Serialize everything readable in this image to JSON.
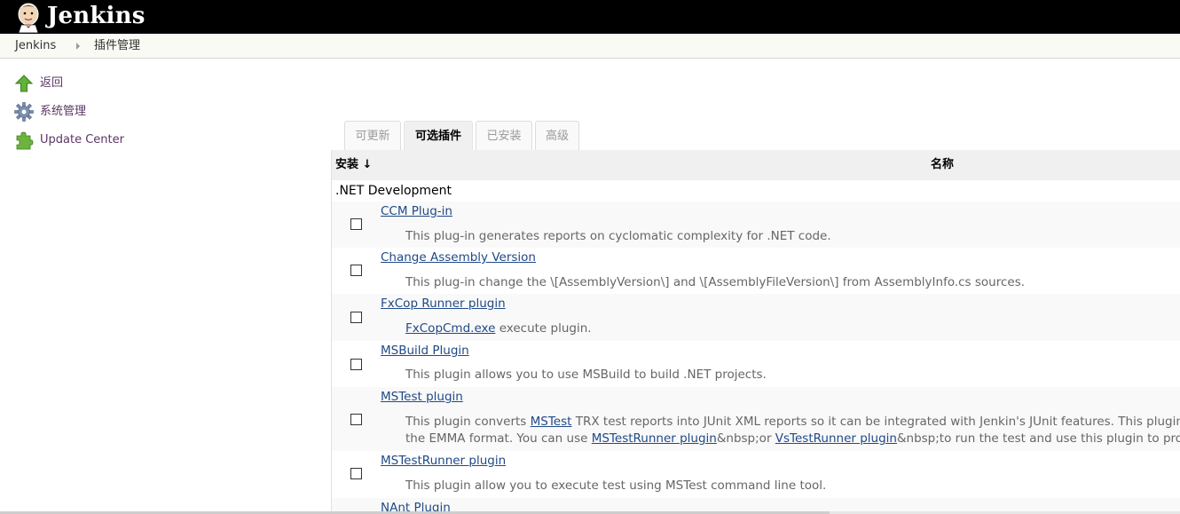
{
  "header": {
    "brand": "Jenkins"
  },
  "breadcrumb": {
    "items": [
      "Jenkins",
      "插件管理"
    ]
  },
  "side_panel": {
    "items": [
      {
        "label": "返回",
        "icon": "up-arrow-icon"
      },
      {
        "label": "系统管理",
        "icon": "gear-icon"
      },
      {
        "label": "Update Center",
        "icon": "puzzle-icon"
      }
    ]
  },
  "tabs": [
    {
      "label": "可更新",
      "active": false
    },
    {
      "label": "可选插件",
      "active": true
    },
    {
      "label": "已安装",
      "active": false
    },
    {
      "label": "高级",
      "active": false
    }
  ],
  "table": {
    "headers": {
      "install": "安装 ↓",
      "name": "名称"
    },
    "category": ".NET Development",
    "plugins": [
      {
        "name": "CCM Plug-in",
        "desc": "This plug-in generates reports on cyclomatic complexity for .NET code."
      },
      {
        "name": "Change Assembly Version",
        "desc": "This plug-in change the \\[AssemblyVersion\\] and \\[AssemblyFileVersion\\] from AssemblyInfo.cs sources."
      },
      {
        "name": "FxCop Runner plugin",
        "desc_link": "FxCopCmd.exe",
        "desc_rest": " execute plugin."
      },
      {
        "name": "MSBuild Plugin",
        "desc": "This plugin allows you to use MSBuild to build .NET projects."
      },
      {
        "name": "MSTest plugin",
        "line1_pre": "This plugin converts ",
        "line1_link": "MSTest",
        "line1_post": " TRX test reports into JUnit XML reports so it can be integrated with Jenkin's JUnit features. This plugin converts",
        "line2_pre": "the EMMA format. You can use ",
        "line2_link1": "MSTestRunner plugin",
        "line2_mid": "&nbsp;or ",
        "line2_link2": "VsTestRunner plugin",
        "line2_post": "&nbsp;to run the test and use this plugin to process the"
      },
      {
        "name": "MSTestRunner plugin",
        "desc": "This plugin allow you to execute test using MSTest command line tool."
      },
      {
        "name": "NAnt Plugin"
      }
    ]
  },
  "colors": {
    "header_bg": "#000000",
    "link": "#204a87",
    "side_link": "#5c3566",
    "row_shade": "#f9f9f9"
  }
}
